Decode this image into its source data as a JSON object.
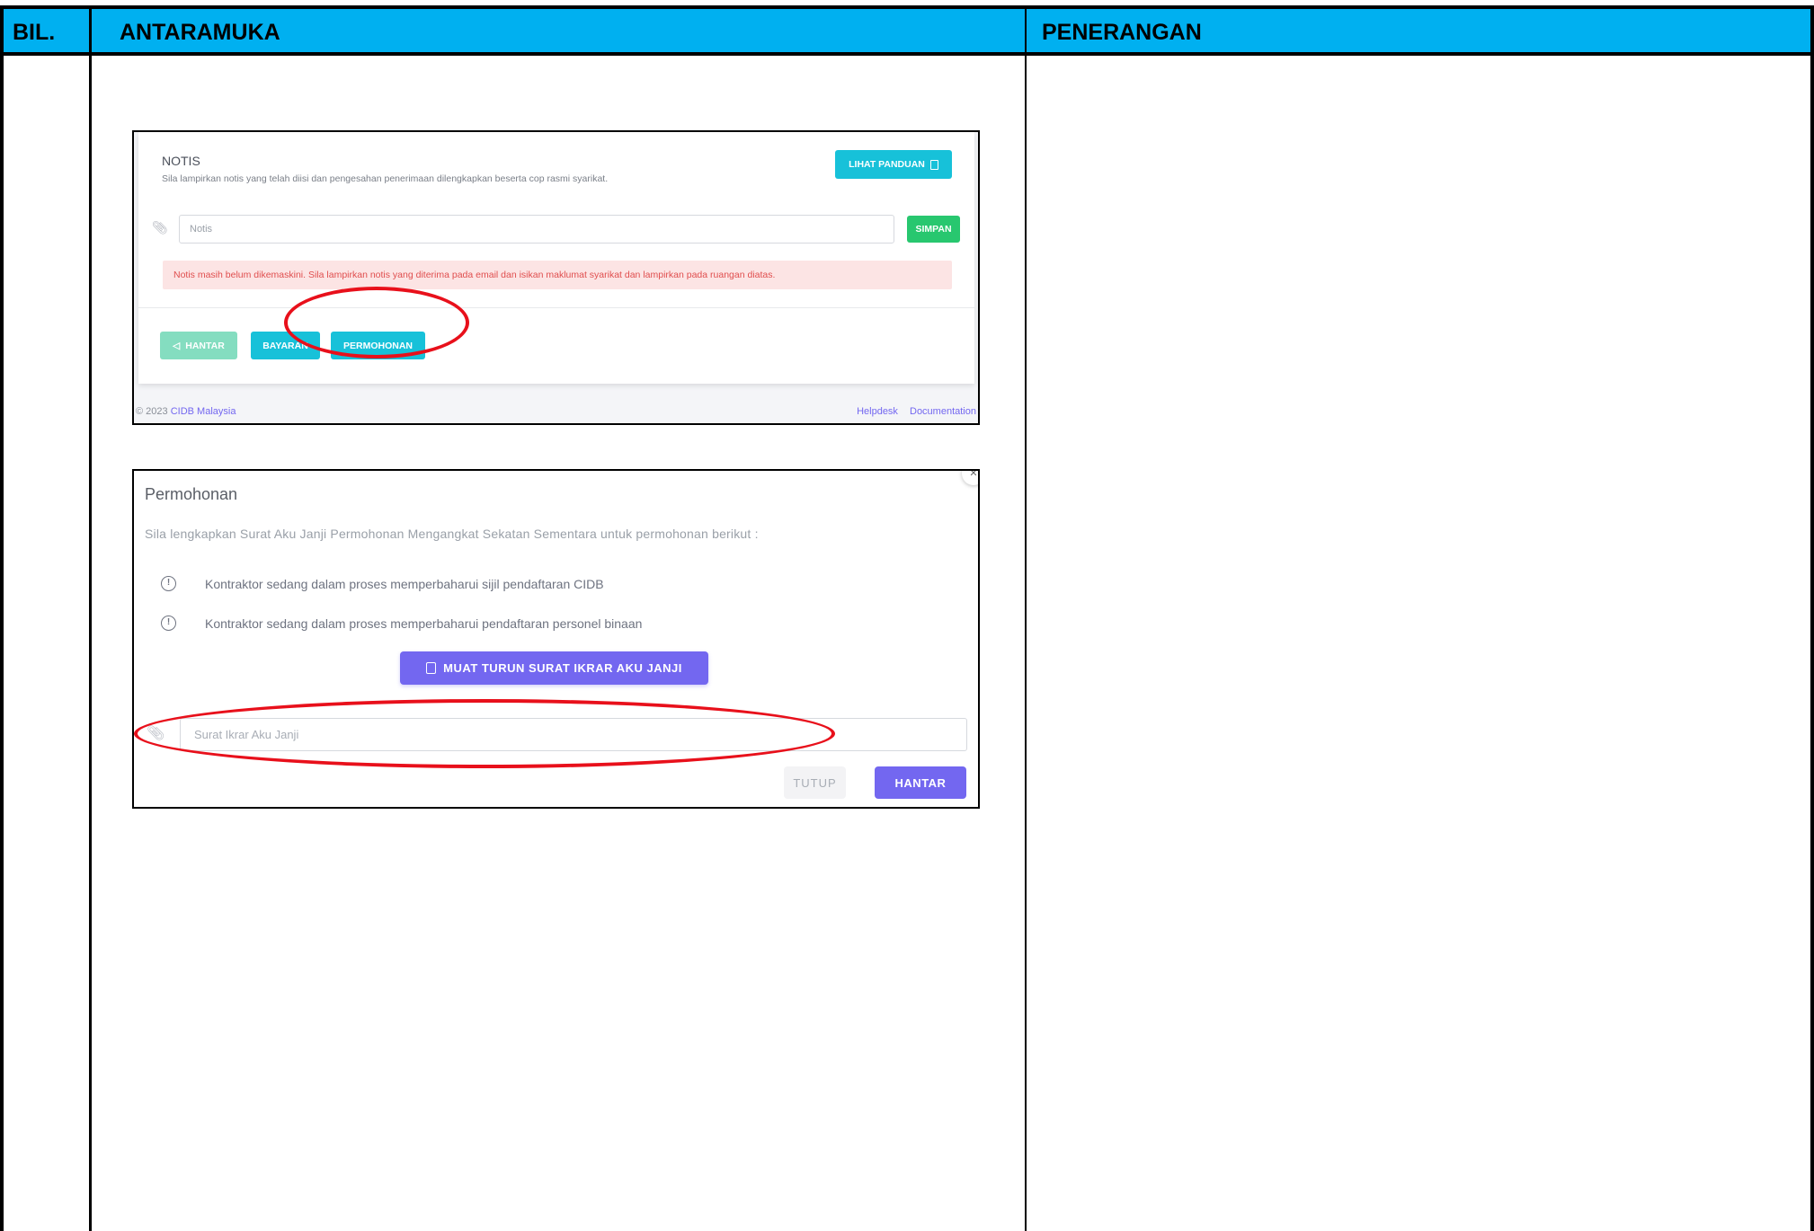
{
  "table": {
    "headers": [
      "BIL.",
      "ANTARAMUKA",
      "PENERANGAN"
    ]
  },
  "notis_panel": {
    "title": "NOTIS",
    "subtitle": "Sila lampirkan notis yang telah diisi dan pengesahan penerimaan dilengkapkan beserta cop rasmi syarikat.",
    "guide_button": "LIHAT PANDUAN",
    "input_placeholder": "Notis",
    "save_button": "SIMPAN",
    "alert": "Notis masih belum dikemaskini. Sila lampirkan notis yang diterima pada email dan isikan maklumat syarikat dan lampirkan pada ruangan diatas.",
    "actions": {
      "hantar": "HANTAR",
      "bayaran": "BAYARAN",
      "permohonan": "PERMOHONAN"
    },
    "footer": {
      "copyright": "© 2023",
      "copyright_link": "CIDB Malaysia",
      "helpdesk": "Helpdesk",
      "documentation": "Documentation"
    }
  },
  "permohonan_modal": {
    "title": "Permohonan",
    "subtitle": "Sila lengkapkan Surat Aku Janji Permohonan Mengangkat Sekatan Sementara untuk permohonan berikut :",
    "items": [
      "Kontraktor sedang dalam proses memperbaharui sijil pendaftaran CIDB",
      "Kontraktor sedang dalam proses memperbaharui pendaftaran personel binaan"
    ],
    "download_button": "MUAT TURUN SURAT IKRAR AKU JANJI",
    "input_placeholder": "Surat Ikrar Aku Janji",
    "close_button": "TUTUP",
    "submit_button": "HANTAR"
  },
  "colors": {
    "header_bg": "#00b0f0",
    "info_button": "#17c1d9",
    "success_button": "#28c76f",
    "primary_purple": "#7367f0",
    "annotation_red": "#e8101b"
  }
}
